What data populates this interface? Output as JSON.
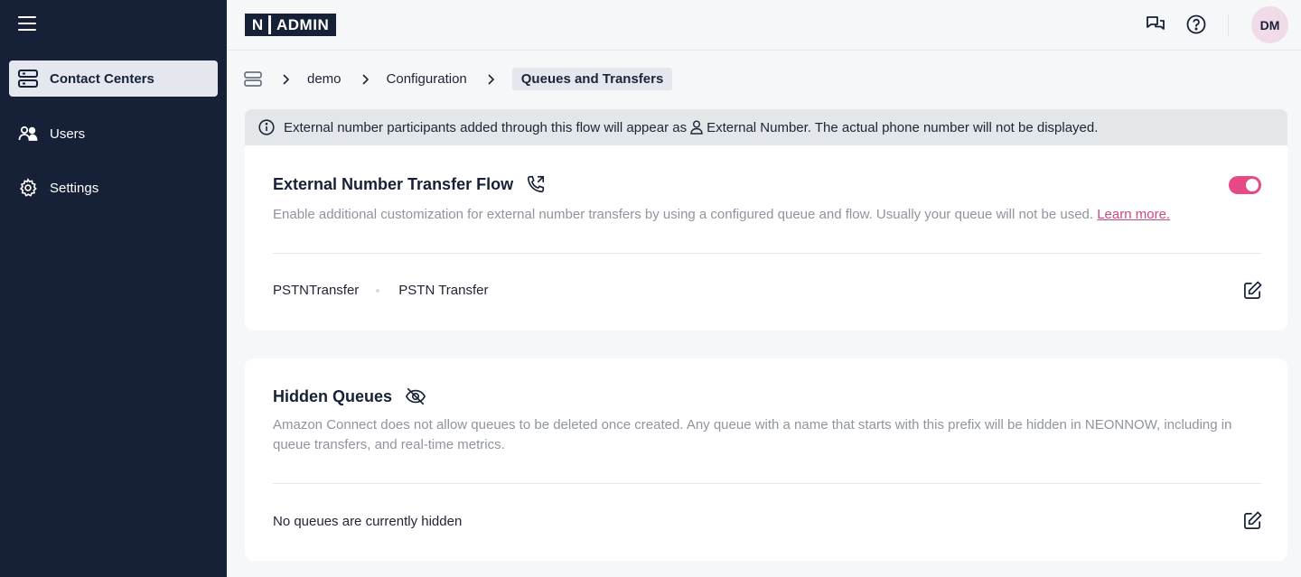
{
  "app": {
    "logo_letter": "N",
    "logo_text": "ADMIN",
    "avatar_initials": "DM"
  },
  "sidebar": {
    "items": [
      {
        "label": "Contact Centers",
        "icon": "server-icon",
        "active": true
      },
      {
        "label": "Users",
        "icon": "users-icon",
        "active": false
      },
      {
        "label": "Settings",
        "icon": "gear-icon",
        "active": false
      }
    ]
  },
  "breadcrumb": {
    "items": [
      "demo",
      "Configuration"
    ],
    "current": "Queues and Transfers"
  },
  "banner": {
    "text_before": "External number participants added through this flow will appear as",
    "text_after": "External Number. The actual phone number will not be displayed."
  },
  "external_transfer": {
    "title": "External Number Transfer Flow",
    "description": "Enable additional customization for external number transfers by using a configured queue and flow. Usually your queue will not be used.",
    "learn_more": "Learn more.",
    "enabled": true,
    "queue_name": "PSTNTransfer",
    "flow_name": "PSTN Transfer"
  },
  "hidden_queues": {
    "title": "Hidden Queues",
    "description": "Amazon Connect does not allow queues to be deleted once created. Any queue with a name that starts with this prefix will be hidden in NEONNOW, including in queue transfers, and real-time metrics.",
    "status": "No queues are currently hidden"
  },
  "colors": {
    "sidebar_bg": "#162036",
    "accent": "#e54a86",
    "link": "#c84a80"
  }
}
